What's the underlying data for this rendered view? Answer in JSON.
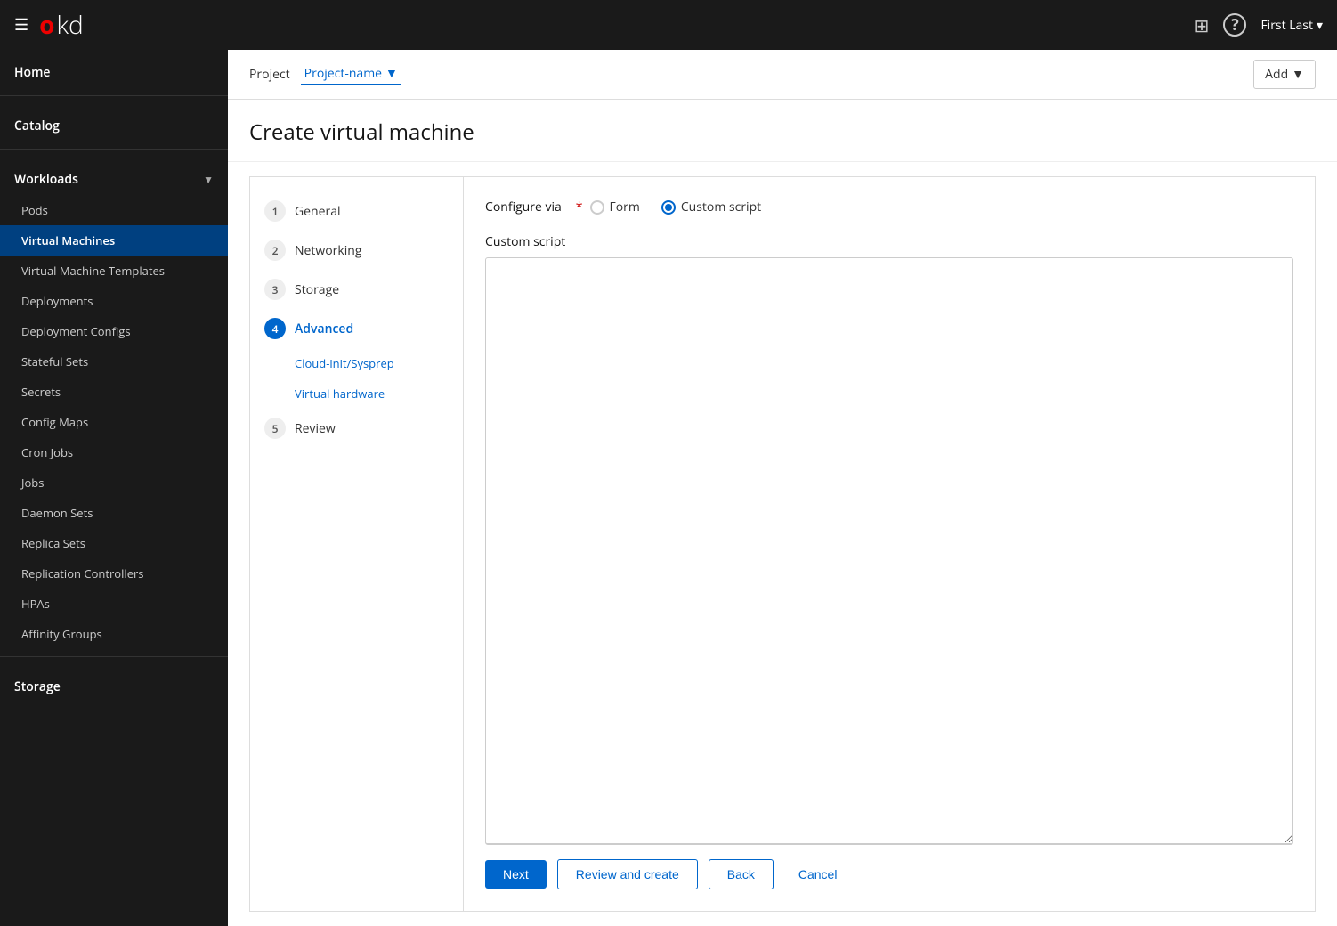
{
  "topnav": {
    "logo_o": "o",
    "logo_kd": "kd",
    "user_label": "First Last",
    "grid_icon": "⊞",
    "help_icon": "?",
    "chevron_icon": "▾",
    "hamburger_icon": "☰"
  },
  "sidebar": {
    "home_label": "Home",
    "catalog_label": "Catalog",
    "workloads_label": "Workloads",
    "items": [
      {
        "id": "pods",
        "label": "Pods"
      },
      {
        "id": "virtual-machines",
        "label": "Virtual Machines",
        "active": true
      },
      {
        "id": "virtual-machine-templates",
        "label": "Virtual Machine Templates"
      },
      {
        "id": "deployments",
        "label": "Deployments"
      },
      {
        "id": "deployment-configs",
        "label": "Deployment Configs"
      },
      {
        "id": "stateful-sets",
        "label": "Stateful Sets"
      },
      {
        "id": "secrets",
        "label": "Secrets"
      },
      {
        "id": "config-maps",
        "label": "Config Maps"
      },
      {
        "id": "cron-jobs",
        "label": "Cron Jobs"
      },
      {
        "id": "jobs",
        "label": "Jobs"
      },
      {
        "id": "daemon-sets",
        "label": "Daemon Sets"
      },
      {
        "id": "replica-sets",
        "label": "Replica Sets"
      },
      {
        "id": "replication-controllers",
        "label": "Replication Controllers"
      },
      {
        "id": "hpas",
        "label": "HPAs"
      },
      {
        "id": "affinity-groups",
        "label": "Affinity Groups"
      }
    ],
    "storage_label": "Storage"
  },
  "header": {
    "project_label": "Project",
    "project_name": "Project-name",
    "add_label": "Add",
    "page_title": "Create virtual machine"
  },
  "wizard": {
    "steps": [
      {
        "number": "1",
        "label": "General",
        "active": false
      },
      {
        "number": "2",
        "label": "Networking",
        "active": false
      },
      {
        "number": "3",
        "label": "Storage",
        "active": false
      },
      {
        "number": "4",
        "label": "Advanced",
        "active": true
      },
      {
        "number": "5",
        "label": "Review",
        "active": false
      }
    ],
    "substeps": [
      {
        "label": "Cloud-init/Sysprep"
      },
      {
        "label": "Virtual hardware"
      }
    ],
    "configure_via_label": "Configure via",
    "required_asterisk": "*",
    "form_label": "Form",
    "custom_script_label": "Custom script",
    "custom_script_textarea_label": "Custom script",
    "textarea_placeholder": ""
  },
  "buttons": {
    "next_label": "Next",
    "review_create_label": "Review and create",
    "back_label": "Back",
    "cancel_label": "Cancel"
  },
  "colors": {
    "active_step_bg": "#0066cc",
    "active_step_text": "#fff",
    "active_substep_text": "#0066cc",
    "next_bg": "#0066cc",
    "next_text": "#fff"
  }
}
